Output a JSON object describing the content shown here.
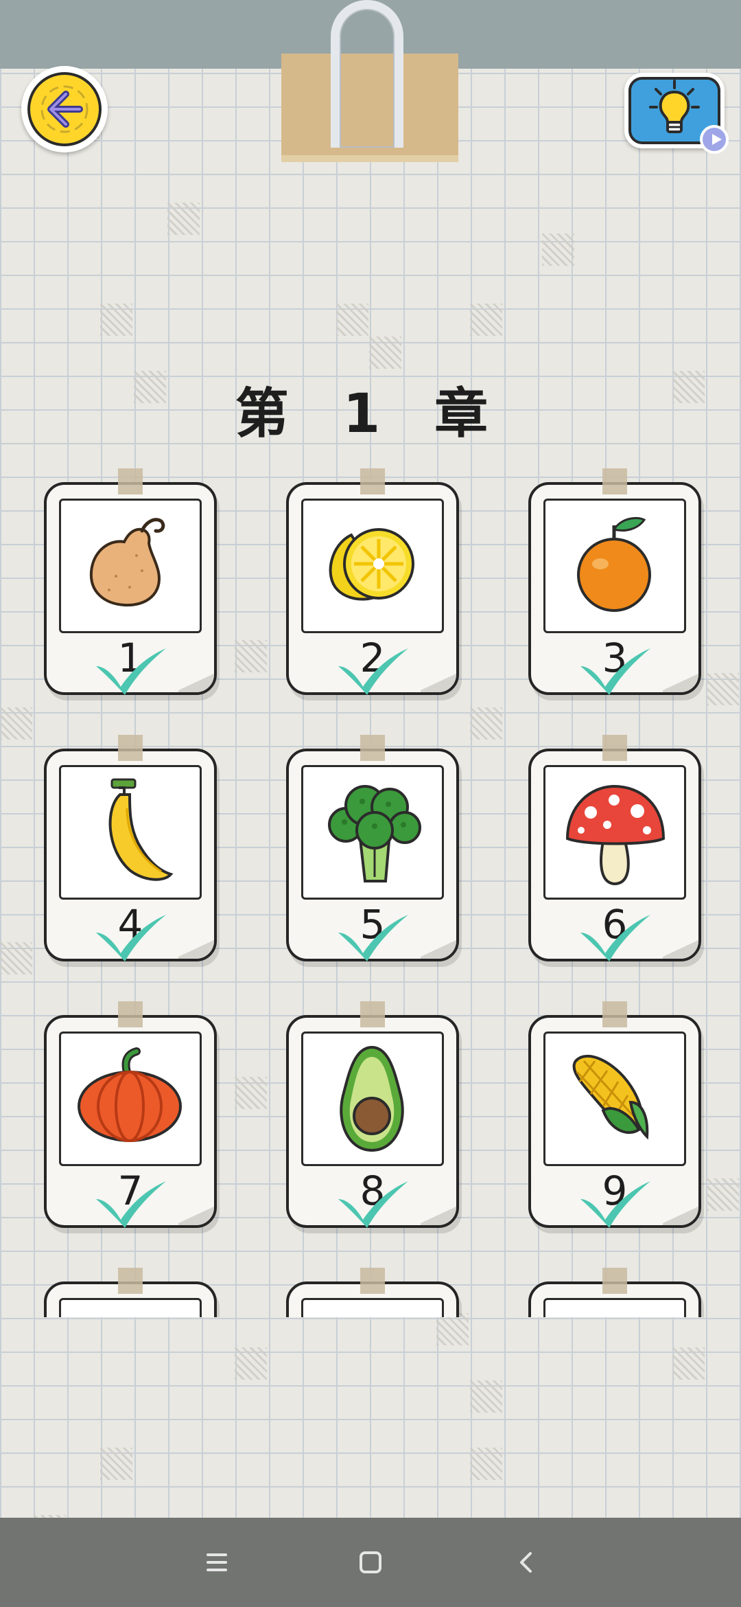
{
  "screen": {
    "chapter_title": "第 1 章"
  },
  "toolbar": {
    "back_icon": "back-arrow-icon",
    "hint_icon": "lightbulb-icon",
    "hint_badge_icon": "video-play-icon"
  },
  "levels": [
    {
      "number": "1",
      "picture": "pear",
      "completed": true
    },
    {
      "number": "2",
      "picture": "lemon",
      "completed": true
    },
    {
      "number": "3",
      "picture": "orange",
      "completed": true
    },
    {
      "number": "4",
      "picture": "banana",
      "completed": true
    },
    {
      "number": "5",
      "picture": "broccoli",
      "completed": true
    },
    {
      "number": "6",
      "picture": "mushroom",
      "completed": true
    },
    {
      "number": "7",
      "picture": "pumpkin",
      "completed": true
    },
    {
      "number": "8",
      "picture": "avocado",
      "completed": true
    },
    {
      "number": "9",
      "picture": "corn",
      "completed": true
    },
    {
      "number": "",
      "picture": "",
      "completed": false
    },
    {
      "number": "",
      "picture": "",
      "completed": false
    },
    {
      "number": "",
      "picture": "",
      "completed": false
    }
  ],
  "navbar": {
    "menu_icon": "menu-icon",
    "home_icon": "home-icon",
    "back_icon": "nav-back-icon"
  },
  "colors": {
    "accent_yellow": "#ffd52a",
    "hint_blue": "#3fa0dd",
    "check_teal": "#4cc6b0"
  }
}
